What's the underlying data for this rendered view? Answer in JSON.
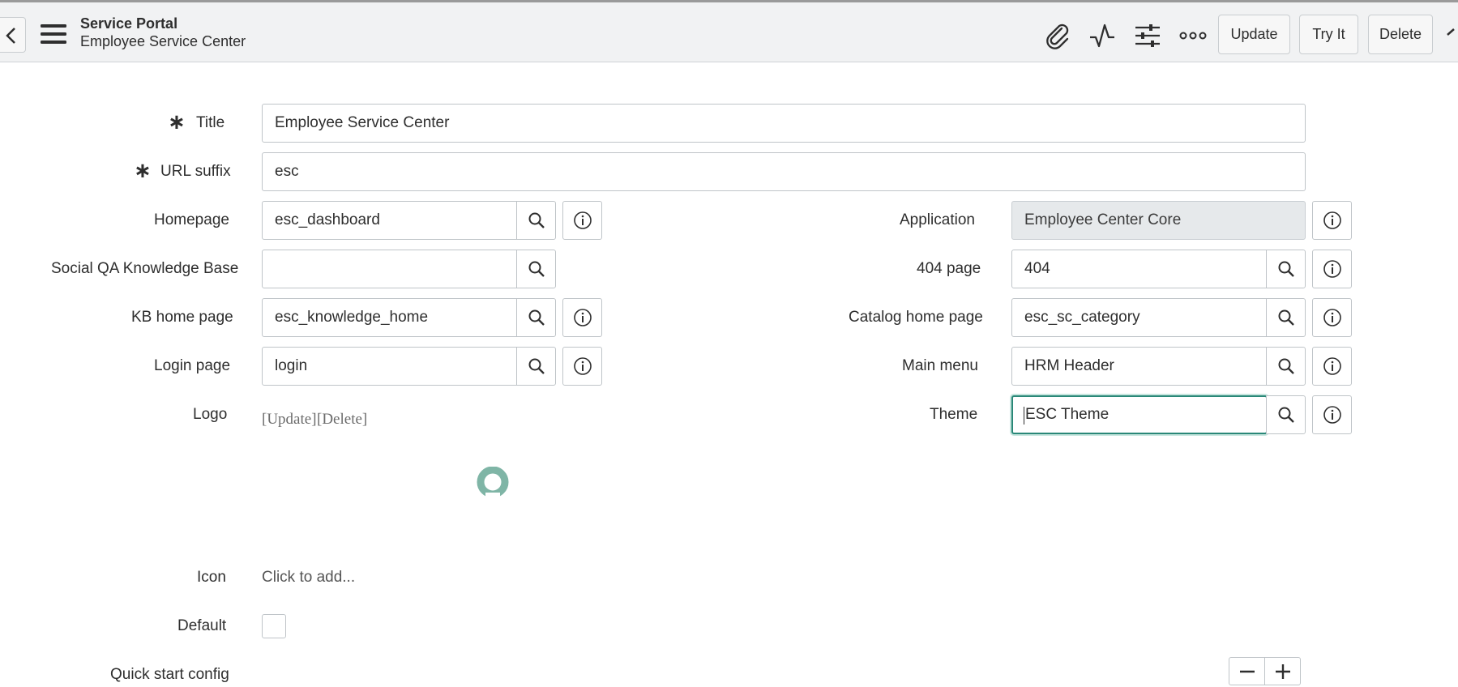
{
  "header": {
    "title": "Service Portal",
    "subtitle": "Employee Service Center",
    "buttons": {
      "update": "Update",
      "try_it": "Try It",
      "delete": "Delete"
    },
    "icons": [
      "back-icon",
      "menu-icon",
      "attachment-icon",
      "activity-icon",
      "settings-icon",
      "more-icon"
    ]
  },
  "form": {
    "title": {
      "label": "Title",
      "value": "Employee Service Center",
      "required_mark": "∗"
    },
    "url_suffix": {
      "label": "URL suffix",
      "value": "esc",
      "required_mark": "∗"
    },
    "homepage": {
      "label": "Homepage",
      "value": "esc_dashboard"
    },
    "social_qa": {
      "label": "Social QA Knowledge Base",
      "value": ""
    },
    "kb_home": {
      "label": "KB home page",
      "value": "esc_knowledge_home"
    },
    "login_page": {
      "label": "Login page",
      "value": "login"
    },
    "logo": {
      "label": "Logo",
      "update": "[Update]",
      "delete": "[Delete]"
    },
    "icon": {
      "label": "Icon",
      "value": "Click to add..."
    },
    "default": {
      "label": "Default",
      "checked": false
    },
    "quick_start": {
      "label": "Quick start config"
    },
    "application": {
      "label": "Application",
      "value": "Employee Center Core"
    },
    "page_404": {
      "label": "404 page",
      "value": "404"
    },
    "catalog_home": {
      "label": "Catalog home page",
      "value": "esc_sc_category"
    },
    "main_menu": {
      "label": "Main menu",
      "value": "HRM Header"
    },
    "theme": {
      "label": "Theme",
      "value": "ESC Theme"
    }
  },
  "colors": {
    "header_bg": "#f1f2f3",
    "focus_border": "#2a8878",
    "logo_accent": "#7fb5a6",
    "readonly_bg": "#e6e9eb"
  }
}
